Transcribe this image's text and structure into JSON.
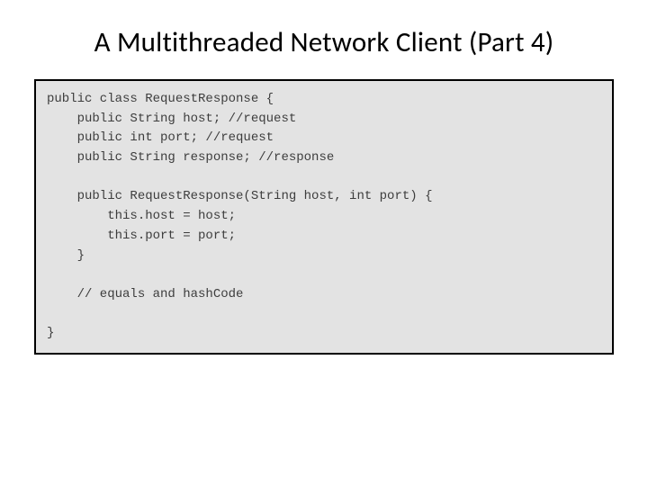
{
  "slide": {
    "title": "A Multithreaded Network Client  (Part 4)",
    "code": "public class RequestResponse {\n    public String host; //request\n    public int port; //request\n    public String response; //response\n\n    public RequestResponse(String host, int port) {\n        this.host = host;\n        this.port = port;\n    }\n\n    // equals and hashCode\n\n}"
  }
}
